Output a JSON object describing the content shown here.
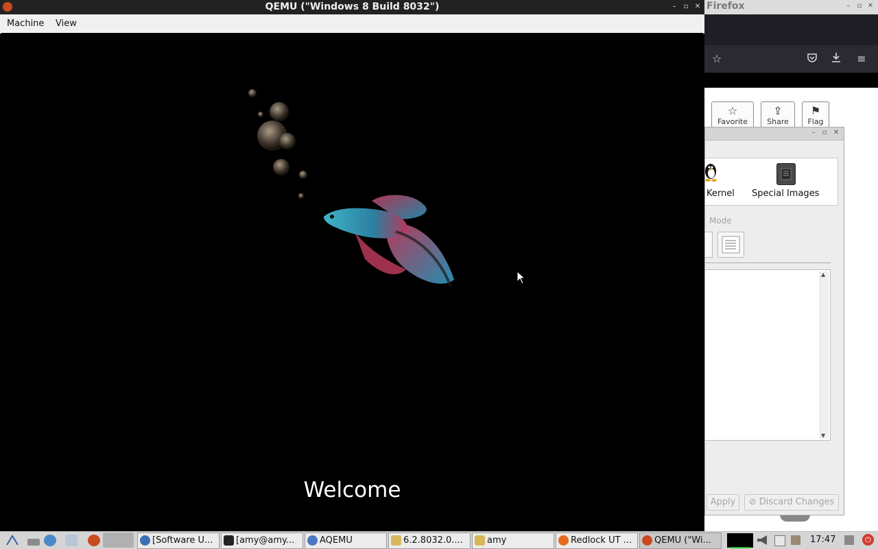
{
  "qemu": {
    "title": "QEMU (\"Windows 8 Build 8032\")",
    "menu": [
      "Machine",
      "View"
    ],
    "screen": {
      "welcome_text": "Welcome"
    }
  },
  "firefox": {
    "title": "Firefox",
    "buttons": [
      {
        "label": "Favorite",
        "icon": "star-icon"
      },
      {
        "label": "Share",
        "icon": "share-icon"
      },
      {
        "label": "Flag",
        "icon": "flag-icon"
      }
    ]
  },
  "aqemu_dialog": {
    "kernel_label": "Kernel",
    "special_images_label": "Special Images",
    "mode_label": "Mode",
    "apply_label": "Apply",
    "discard_label": "Discard Changes"
  },
  "taskbar": {
    "tasks": [
      {
        "label": "[Software U...",
        "icon": "browser-icon"
      },
      {
        "label": "[amy@amy...",
        "icon": "terminal-icon"
      },
      {
        "label": "AQEMU",
        "icon": "aqemu-icon"
      },
      {
        "label": "6.2.8032.0....",
        "icon": "folder-icon"
      },
      {
        "label": "amy",
        "icon": "folder-icon"
      },
      {
        "label": "Redlock UT ...",
        "icon": "firefox-icon"
      },
      {
        "label": "QEMU (\"Wi...",
        "icon": "qemu-icon"
      }
    ],
    "clock": "17:47"
  }
}
